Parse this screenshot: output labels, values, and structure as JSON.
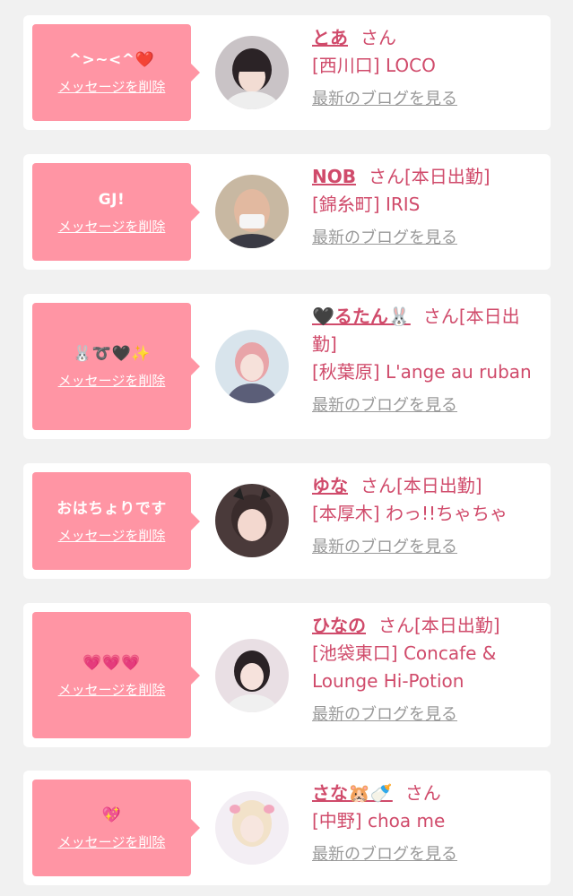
{
  "common": {
    "delete_label": "メッセージを削除",
    "blog_label": "最新のブログを見る",
    "honorific": "さん"
  },
  "colors": {
    "bubble": "#ff95a4",
    "accent": "#d04b6b",
    "muted": "#999999",
    "background": "#f1f1f1"
  },
  "items": [
    {
      "message": "^>~<^❤️",
      "name": "とあ",
      "status": "",
      "shop": "[西川口] LOCO"
    },
    {
      "message": "GJ!",
      "name": "NOB",
      "status": "[本日出勤]",
      "shop": "[錦糸町] IRIS"
    },
    {
      "message": "🐰➰🖤✨",
      "name": "🖤るたん🐰",
      "status": "[本日出勤]",
      "shop": "[秋葉原] L'ange au ruban"
    },
    {
      "message": "おはちょりです",
      "name": "ゆな",
      "status": "[本日出勤]",
      "shop": "[本厚木] わっ!!ちゃちゃ"
    },
    {
      "message": "💗💗💗",
      "name": "ひなの",
      "status": "[本日出勤]",
      "shop": "[池袋東口] Concafe & Lounge Hi-Potion"
    },
    {
      "message": "💖",
      "name": "さな🐹🍼",
      "status": "",
      "shop": "[中野] choa me"
    }
  ]
}
